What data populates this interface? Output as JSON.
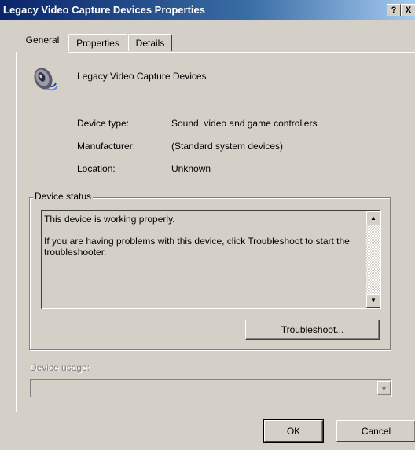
{
  "window": {
    "title": "Legacy Video Capture Devices Properties",
    "help_label": "?",
    "close_label": "X"
  },
  "tabs": [
    {
      "label": "General",
      "active": true
    },
    {
      "label": "Properties",
      "active": false
    },
    {
      "label": "Details",
      "active": false
    }
  ],
  "device": {
    "name": "Legacy Video Capture Devices",
    "icon": "speaker-icon",
    "fields": [
      {
        "label": "Device type:",
        "value": "Sound, video and game controllers"
      },
      {
        "label": "Manufacturer:",
        "value": "(Standard system devices)"
      },
      {
        "label": "Location:",
        "value": "Unknown"
      }
    ]
  },
  "status": {
    "legend": "Device status",
    "line1": "This device is working properly.",
    "line2": "If you are having problems with this device, click Troubleshoot to start the troubleshooter.",
    "troubleshoot_label": "Troubleshoot..."
  },
  "usage": {
    "label": "Device usage:",
    "value": ""
  },
  "footer": {
    "ok_label": "OK",
    "cancel_label": "Cancel"
  }
}
